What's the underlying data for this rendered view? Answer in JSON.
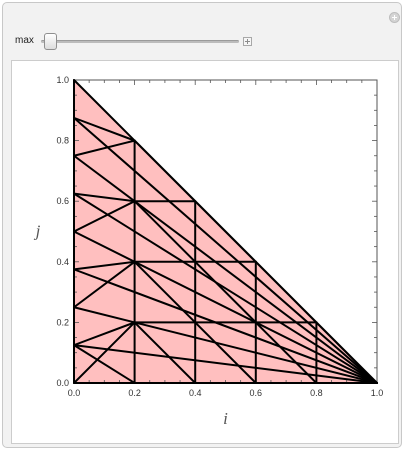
{
  "control": {
    "label": "max",
    "slider_value": 0.05
  },
  "icons": {
    "reset": "reset-icon",
    "expand": "plus-icon"
  },
  "colors": {
    "fill": "#ffbfbf",
    "line": "#000000",
    "panel": "#f2f2f2"
  },
  "chart_data": {
    "type": "line",
    "xlabel": "i",
    "ylabel": "j",
    "xlim": [
      0,
      1
    ],
    "ylim": [
      0,
      1
    ],
    "x_ticks": [
      0.0,
      0.2,
      0.4,
      0.6,
      0.8,
      1.0
    ],
    "y_ticks": [
      0.0,
      0.2,
      0.4,
      0.6,
      0.8,
      1.0
    ],
    "tick_labels_x": [
      "0.0",
      "0.2",
      "0.4",
      "0.6",
      "0.8",
      "1.0"
    ],
    "tick_labels_y": [
      "0.0",
      "0.2",
      "0.4",
      "0.6",
      "0.8",
      "1.0"
    ],
    "region": [
      [
        0,
        0
      ],
      [
        1,
        0
      ],
      [
        0,
        1
      ]
    ],
    "segments": [
      [
        [
          0,
          1
        ],
        [
          1,
          0
        ]
      ],
      [
        [
          0,
          0
        ],
        [
          1,
          0
        ]
      ],
      [
        [
          0,
          0
        ],
        [
          0,
          1
        ]
      ],
      [
        [
          0.2,
          0
        ],
        [
          0.2,
          0.8
        ]
      ],
      [
        [
          0.4,
          0
        ],
        [
          0.4,
          0.6
        ]
      ],
      [
        [
          0.6,
          0
        ],
        [
          0.6,
          0.4
        ]
      ],
      [
        [
          0.8,
          0
        ],
        [
          0.8,
          0.2
        ]
      ],
      [
        [
          0,
          0.875
        ],
        [
          1,
          0
        ]
      ],
      [
        [
          0,
          0.75
        ],
        [
          1,
          0
        ]
      ],
      [
        [
          0,
          0.625
        ],
        [
          1,
          0
        ]
      ],
      [
        [
          0,
          0.5
        ],
        [
          1,
          0
        ]
      ],
      [
        [
          0,
          0.375
        ],
        [
          1,
          0
        ]
      ],
      [
        [
          0,
          0.25
        ],
        [
          1,
          0
        ]
      ],
      [
        [
          0,
          0.125
        ],
        [
          1,
          0
        ]
      ],
      [
        [
          0,
          0.875
        ],
        [
          0.2,
          0.8
        ]
      ],
      [
        [
          0,
          0.75
        ],
        [
          0.2,
          0.8
        ]
      ],
      [
        [
          0,
          0.625
        ],
        [
          0.2,
          0.6
        ]
      ],
      [
        [
          0,
          0.5
        ],
        [
          0.2,
          0.6
        ]
      ],
      [
        [
          0,
          0.375
        ],
        [
          0.2,
          0.4
        ]
      ],
      [
        [
          0,
          0.25
        ],
        [
          0.2,
          0.4
        ]
      ],
      [
        [
          0,
          0.125
        ],
        [
          0.2,
          0.2
        ]
      ],
      [
        [
          0,
          0
        ],
        [
          0.2,
          0.2
        ]
      ],
      [
        [
          0,
          0.125
        ],
        [
          0.2,
          0
        ]
      ],
      [
        [
          0.2,
          0.8
        ],
        [
          0.4,
          0.6
        ]
      ],
      [
        [
          0.2,
          0.6
        ],
        [
          0.4,
          0.6
        ]
      ],
      [
        [
          0.2,
          0.6
        ],
        [
          0.4,
          0.4
        ]
      ],
      [
        [
          0.2,
          0.4
        ],
        [
          0.4,
          0.4
        ]
      ],
      [
        [
          0.2,
          0.4
        ],
        [
          0.4,
          0.2
        ]
      ],
      [
        [
          0.2,
          0.2
        ],
        [
          0.4,
          0.2
        ]
      ],
      [
        [
          0.2,
          0.2
        ],
        [
          0.4,
          0
        ]
      ],
      [
        [
          0.2,
          0
        ],
        [
          0.4,
          0
        ]
      ],
      [
        [
          0.4,
          0.6
        ],
        [
          0.6,
          0.4
        ]
      ],
      [
        [
          0.4,
          0.4
        ],
        [
          0.6,
          0.4
        ]
      ],
      [
        [
          0.4,
          0.4
        ],
        [
          0.6,
          0.2
        ]
      ],
      [
        [
          0.4,
          0.2
        ],
        [
          0.6,
          0.2
        ]
      ],
      [
        [
          0.4,
          0.2
        ],
        [
          0.6,
          0
        ]
      ],
      [
        [
          0.6,
          0.4
        ],
        [
          0.8,
          0.2
        ]
      ],
      [
        [
          0.6,
          0.2
        ],
        [
          0.8,
          0.2
        ]
      ],
      [
        [
          0.6,
          0.2
        ],
        [
          0.8,
          0
        ]
      ],
      [
        [
          0.8,
          0.2
        ],
        [
          1,
          0
        ]
      ]
    ]
  }
}
